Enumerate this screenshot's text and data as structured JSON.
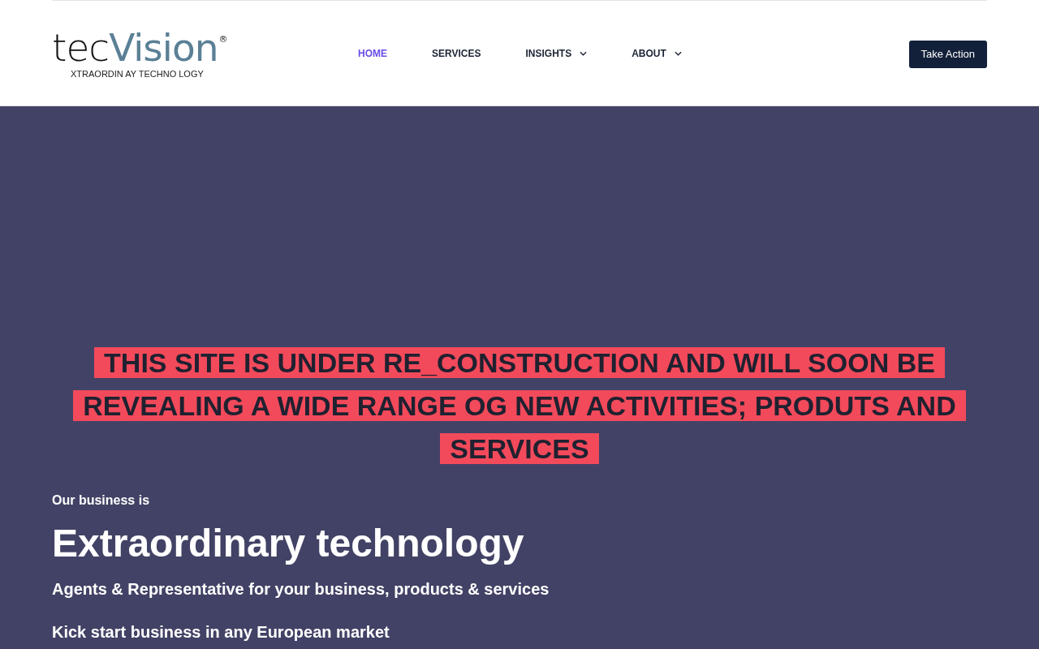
{
  "logo": {
    "brand_dark": "tec",
    "brand_light": "Vision",
    "registered": "®",
    "tagline": "XTRAORDIN AY TECHNO LOGY"
  },
  "nav": [
    {
      "label": "HOME",
      "selected": true,
      "dropdown": false
    },
    {
      "label": "SERVICES",
      "selected": false,
      "dropdown": false
    },
    {
      "label": "INSIGHTS",
      "selected": false,
      "dropdown": true
    },
    {
      "label": "ABOUT",
      "selected": false,
      "dropdown": true
    }
  ],
  "cta_button": "Take Action",
  "hero": {
    "notice": "THIS SITE IS UNDER RE_CONSTRUCTION AND WILL SOON BE REVEALING A WIDE RANGE OG NEW ACTIVITIES; PRODUTS AND SERVICES",
    "eyebrow": "Our business is",
    "headline": "Extraordinary technology",
    "subheadline": "Agents & Representative for your business, products & services",
    "tagline": "Kick start business in any European market"
  }
}
